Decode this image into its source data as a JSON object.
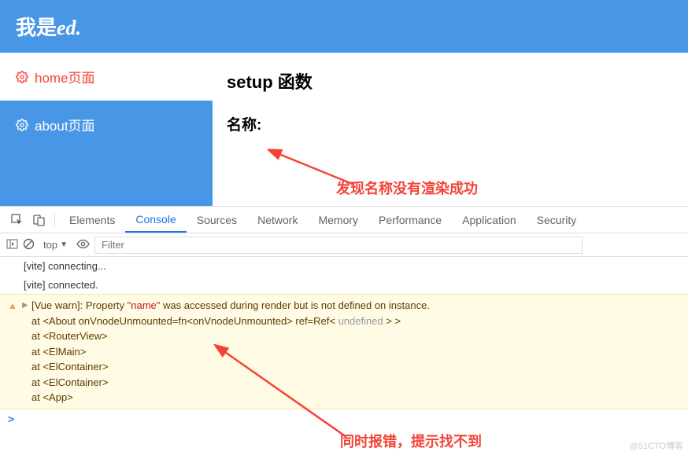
{
  "header": {
    "title_1": "我是",
    "title_2": "ed."
  },
  "sidebar": {
    "items": [
      {
        "label": "home页面"
      },
      {
        "label": "about页面"
      }
    ]
  },
  "content": {
    "heading": "setup 函数",
    "label": "名称:"
  },
  "annotations": {
    "top": "发现名称没有渲染成功",
    "bottom": "同时报错，提示找不到"
  },
  "devtools": {
    "tabs": [
      "Elements",
      "Console",
      "Sources",
      "Network",
      "Memory",
      "Performance",
      "Application",
      "Security"
    ],
    "active_tab": "Console",
    "toolbar": {
      "context": "top",
      "filter_placeholder": "Filter"
    },
    "logs": [
      "[vite] connecting...",
      "[vite] connected."
    ],
    "warning": {
      "prefix": "[Vue warn]: Property ",
      "prop": "\"name\"",
      "suffix": " was accessed during render but is not defined on instance.",
      "stack": [
        "at <About onVnodeUnmounted=fn<onVnodeUnmounted> ref=Ref< undefined > >",
        "at <RouterView>",
        "at <ElMain>",
        "at <ElContainer>",
        "at <ElContainer>",
        "at <App>"
      ]
    }
  },
  "watermark": "@51CTO博客"
}
